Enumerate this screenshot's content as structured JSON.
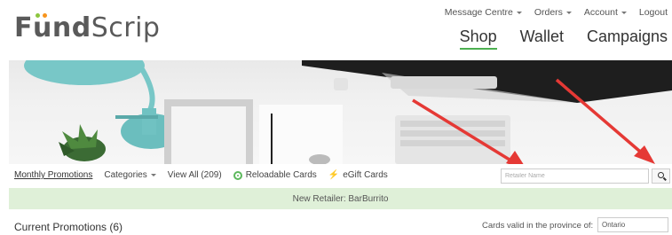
{
  "brand": {
    "logo_pre": "F",
    "logo_u": "u",
    "logo_bold_rest": "nd",
    "logo_thin": "Scrip"
  },
  "utility_nav": [
    {
      "label": "Message Centre",
      "dropdown": true
    },
    {
      "label": "Orders",
      "dropdown": true
    },
    {
      "label": "Account",
      "dropdown": true
    },
    {
      "label": "Logout",
      "dropdown": false
    }
  ],
  "main_nav": [
    {
      "label": "Shop",
      "active": true
    },
    {
      "label": "Wallet",
      "active": false
    },
    {
      "label": "Campaigns",
      "active": false
    }
  ],
  "category_nav": {
    "monthly_promotions": "Monthly Promotions",
    "categories": "Categories",
    "view_all": "View All (209)",
    "reloadable_cards": "Reloadable Cards",
    "egift_cards": "eGift Cards"
  },
  "search": {
    "placeholder": "Retailer Name",
    "value": ""
  },
  "announcement": "New Retailer: BarBurrito",
  "promotions": {
    "title": "Current Promotions (6)",
    "province_label": "Cards valid in the province of:",
    "province_value": "Ontario"
  },
  "colors": {
    "accent_green": "#4caf50",
    "announcement_bg": "#dff0d8",
    "arrow_red": "#e53935",
    "logo_dot_green": "#8cc63f",
    "logo_dot_orange": "#f7941d"
  }
}
